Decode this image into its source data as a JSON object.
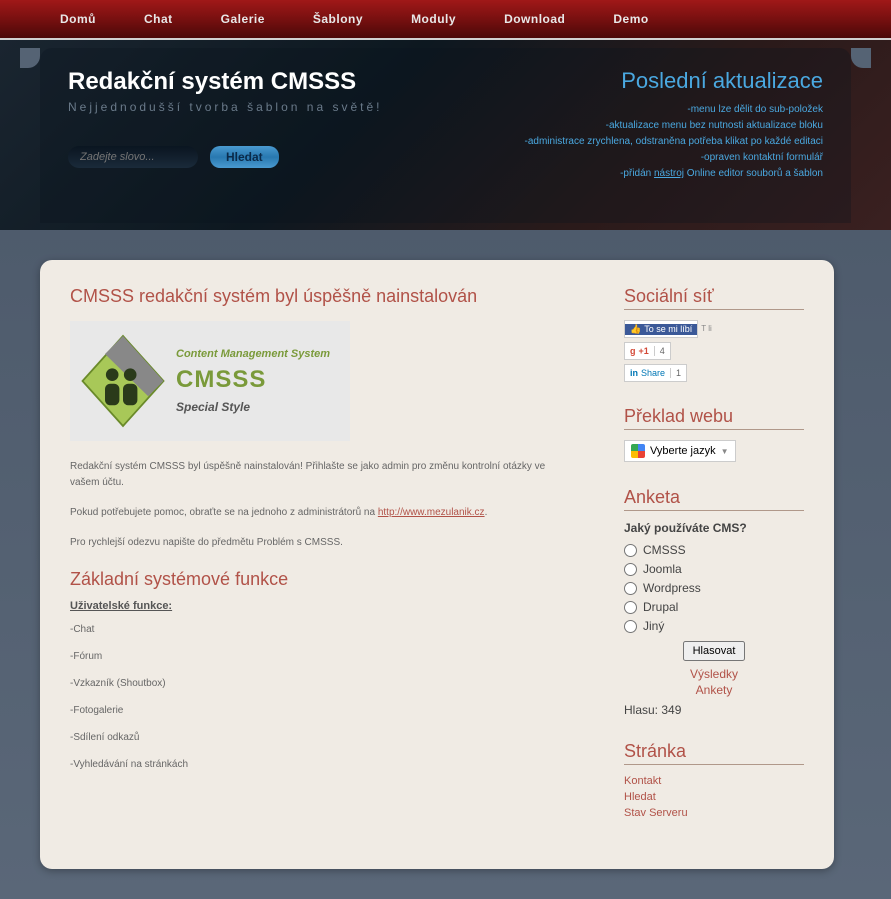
{
  "nav": [
    "Domů",
    "Chat",
    "Galerie",
    "Šablony",
    "Moduly",
    "Download",
    "Demo"
  ],
  "site": {
    "title": "Redakční systém CMSSS",
    "tagline": "Nejjednodušší tvorba šablon na světě!"
  },
  "search": {
    "placeholder": "Zadejte slovo...",
    "button": "Hledat"
  },
  "updates": {
    "title": "Poslední aktualizace",
    "items": [
      "-menu lze dělit do sub-položek",
      "-aktualizace menu bez nutnosti aktualizace bloku",
      "-administrace zrychlena, odstraněna potřeba klikat po každé editaci",
      "-opraven kontaktní formulář"
    ],
    "last_prefix": "-přidán ",
    "last_link": "nástroj",
    "last_suffix": " Online editor souborů a šablon"
  },
  "article": {
    "title": "CMSSS redakční systém byl úspěšně nainstalován",
    "logo": {
      "l1": "Content Management System",
      "l2": "CMSSS",
      "l3": "Special Style"
    },
    "p1": "Redakční systém CMSSS byl úspěšně nainstalován! Přihlašte se jako admin pro změnu kontrolní otázky ve vašem účtu.",
    "p2_prefix": "Pokud potřebujete pomoc, obraťte se na jednoho z administrátorů na ",
    "p2_link": "http://www.mezulanik.cz",
    "p2_suffix": ".",
    "p3": "Pro rychlejší odezvu napište do předmětu Problém s CMSSS.",
    "section": "Základní systémové funkce",
    "sub": "Uživatelské funkce:",
    "features": [
      "-Chat",
      "-Fórum",
      "-Vzkazník (Shoutbox)",
      "-Fotogalerie",
      "-Sdílení odkazů",
      "-Vyhledávání na stránkách"
    ]
  },
  "sidebar": {
    "social": {
      "title": "Sociální síť",
      "fb": "To se mi líbí",
      "fb_extra": "T\nli",
      "gp_label": "+1",
      "gp_count": "4",
      "in_label": "Share",
      "in_count": "1"
    },
    "translate": {
      "title": "Překlad webu",
      "button": "Vyberte jazyk"
    },
    "poll": {
      "title": "Anketa",
      "question": "Jaký používáte CMS?",
      "options": [
        "CMSSS",
        "Joomla",
        "Wordpress",
        "Drupal",
        "Jiný"
      ],
      "vote": "Hlasovat",
      "results": "Výsledky",
      "polls": "Ankety",
      "count_label": "Hlasu: ",
      "count": "349"
    },
    "page": {
      "title": "Stránka",
      "links": [
        "Kontakt",
        "Hledat",
        "Stav Serveru"
      ]
    }
  }
}
